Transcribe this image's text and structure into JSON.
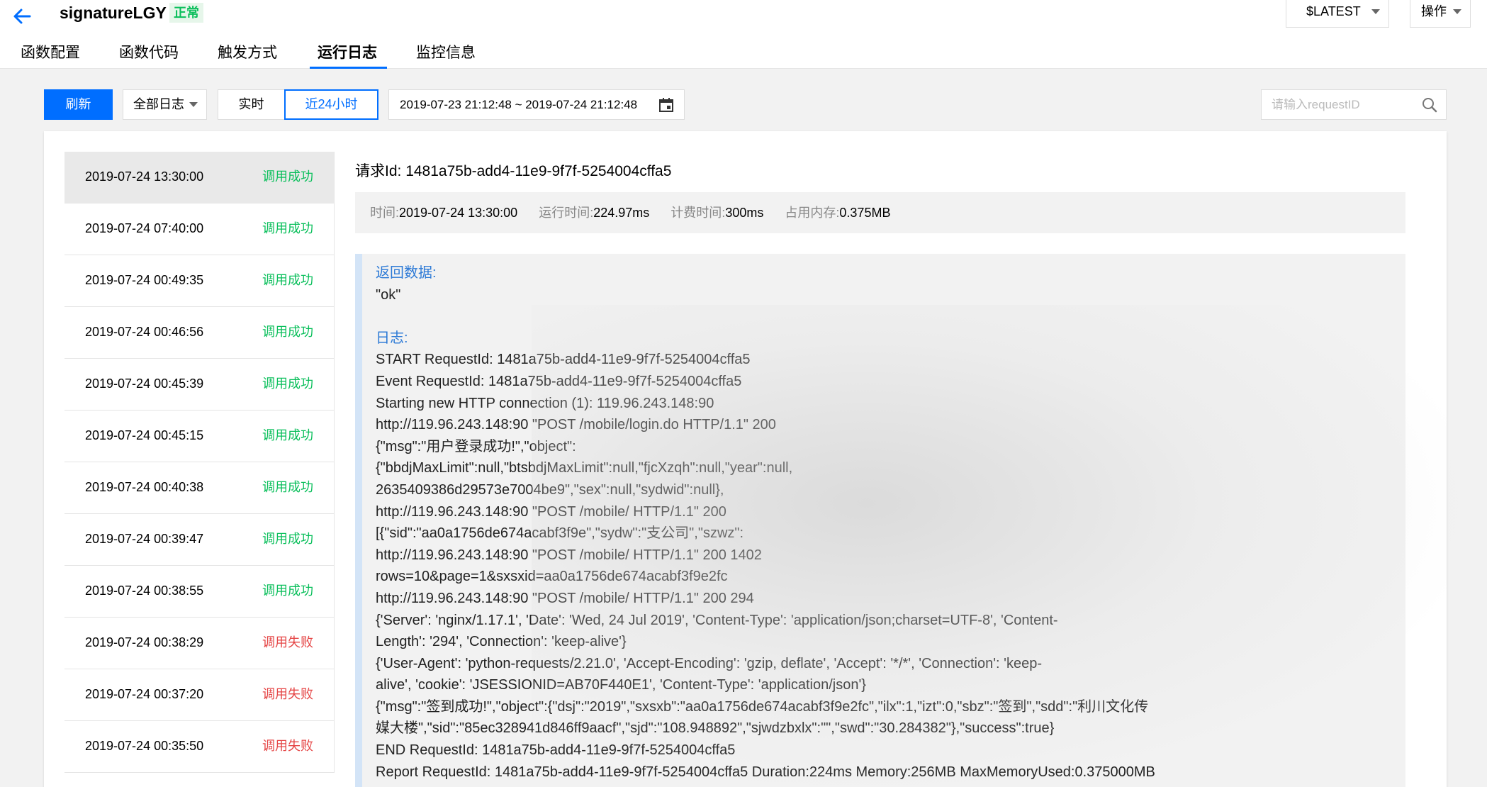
{
  "header": {
    "function_name": "signatureLGY",
    "status": "正常",
    "version": "$LATEST",
    "operations": "操作"
  },
  "tabs": [
    "函数配置",
    "函数代码",
    "触发方式",
    "运行日志",
    "监控信息"
  ],
  "active_tab": "运行日志",
  "toolbar": {
    "refresh": "刷新",
    "log_type": "全部日志",
    "realtime": "实时",
    "recent": "近24小时",
    "date_range": "2019-07-23 21:12:48 ~ 2019-07-24 21:12:48",
    "search_placeholder": "请输入requestID"
  },
  "log_list": [
    {
      "time": "2019-07-24 13:30:00",
      "status": "调用成功",
      "ok": true
    },
    {
      "time": "2019-07-24 07:40:00",
      "status": "调用成功",
      "ok": true
    },
    {
      "time": "2019-07-24 00:49:35",
      "status": "调用成功",
      "ok": true
    },
    {
      "time": "2019-07-24 00:46:56",
      "status": "调用成功",
      "ok": true
    },
    {
      "time": "2019-07-24 00:45:39",
      "status": "调用成功",
      "ok": true
    },
    {
      "time": "2019-07-24 00:45:15",
      "status": "调用成功",
      "ok": true
    },
    {
      "time": "2019-07-24 00:40:38",
      "status": "调用成功",
      "ok": true
    },
    {
      "time": "2019-07-24 00:39:47",
      "status": "调用成功",
      "ok": true
    },
    {
      "time": "2019-07-24 00:38:55",
      "status": "调用成功",
      "ok": true
    },
    {
      "time": "2019-07-24 00:38:29",
      "status": "调用失败",
      "ok": false
    },
    {
      "time": "2019-07-24 00:37:20",
      "status": "调用失败",
      "ok": false
    },
    {
      "time": "2019-07-24 00:35:50",
      "status": "调用失败",
      "ok": false
    }
  ],
  "detail": {
    "request_label": "请求Id:",
    "request_id": "1481a75b-add4-11e9-9f7f-5254004cffa5",
    "time_label": "时间:",
    "time": "2019-07-24 13:30:00",
    "run_time_label": "运行时间:",
    "run_time": "224.97ms",
    "billed_time_label": "计费时间:",
    "billed_time": "300ms",
    "memory_label": "占用内存:",
    "memory": "0.375MB",
    "return_label": "返回数据:",
    "return_value": "\"ok\"",
    "log_label": "日志:",
    "log_lines": [
      "START RequestId: 1481a75b-add4-11e9-9f7f-5254004cffa5",
      "Event RequestId: 1481a75b-add4-11e9-9f7f-5254004cffa5",
      "Starting new HTTP connection (1): 119.96.243.148:90",
      "http://119.96.243.148:90 \"POST /mobile/login.do HTTP/1.1\" 200",
      "{\"msg\":\"用户登录成功!\",\"object\":",
      "{\"bbdjMaxLimit\":null,\"btsbdjMaxLimit\":null,\"fjcXzqh\":null,\"year\":null,",
      "2635409386d29573e7004be9\",\"sex\":null,\"sydwid\":null},",
      "http://119.96.243.148:90 \"POST /mobile/ HTTP/1.1\" 200",
      "[{\"sid\":\"aa0a1756de674acabf3f9e\",\"sydw\":\"支公司\",\"szwz\":",
      "http://119.96.243.148:90 \"POST /mobile/ HTTP/1.1\" 200 1402",
      "rows=10&page=1&sxsxid=aa0a1756de674acabf3f9e2fc",
      "http://119.96.243.148:90 \"POST /mobile/ HTTP/1.1\" 200 294",
      "{'Server': 'nginx/1.17.1', 'Date': 'Wed, 24 Jul 2019', 'Content-Type': 'application/json;charset=UTF-8', 'Content-",
      "Length': '294', 'Connection': 'keep-alive'}",
      "{'User-Agent': 'python-requests/2.21.0', 'Accept-Encoding': 'gzip, deflate', 'Accept': '*/*', 'Connection': 'keep-",
      "alive', 'cookie': 'JSESSIONID=AB70F440E1', 'Content-Type': 'application/json'}",
      "{\"msg\":\"签到成功!\",\"object\":{\"dsj\":\"2019\",\"sxsxb\":\"aa0a1756de674acabf3f9e2fc\",\"ilx\":1,\"izt\":0,\"sbz\":\"签到\",\"sdd\":\"利川文化传",
      "媒大楼\",\"sid\":\"85ec328941d846ff9aacf\",\"sjd\":\"108.948892\",\"sjwdzbxlx\":\"\",\"swd\":\"30.284382\"},\"success\":true}",
      "END RequestId: 1481a75b-add4-11e9-9f7f-5254004cffa5",
      "Report RequestId: 1481a75b-add4-11e9-9f7f-5254004cffa5 Duration:224ms Memory:256MB MaxMemoryUsed:0.375000MB"
    ]
  },
  "colors": {
    "primary": "#006eff",
    "success": "#0abf5b",
    "fail": "#e54545",
    "section_title": "#2d7ad6"
  },
  "icons": [
    "back-arrow-icon",
    "calendar-icon",
    "search-icon",
    "chevron-down-icon"
  ]
}
